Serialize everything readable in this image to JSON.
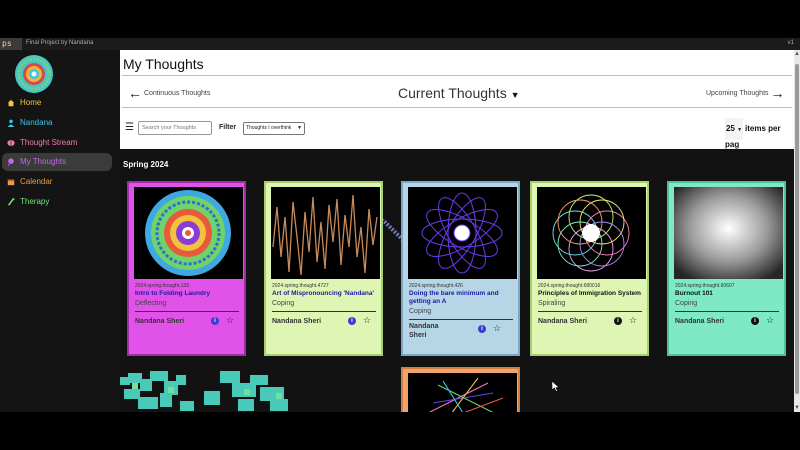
{
  "window": {
    "logo": "ps",
    "title": "Final Project by Nandana",
    "version": "v1"
  },
  "sidebar": {
    "items": [
      {
        "label": "Home",
        "color": "#f4c542",
        "icon": "home-icon"
      },
      {
        "label": "Nandana",
        "color": "#35c8e8",
        "icon": "person-icon"
      },
      {
        "label": "Thought Stream",
        "color": "#f07ab4",
        "icon": "brain-icon"
      },
      {
        "label": "My Thoughts",
        "color": "#c06ae8",
        "icon": "thought-icon"
      },
      {
        "label": "Calendar",
        "color": "#f09a4a",
        "icon": "calendar-icon"
      },
      {
        "label": "Therapy",
        "color": "#6ee66e",
        "icon": "therapy-icon"
      }
    ]
  },
  "page": {
    "title": "My Thoughts"
  },
  "nav": {
    "prev": "Continuous Thoughts",
    "current": "Current Thoughts",
    "next": "Upcoming Thoughts"
  },
  "toolbar": {
    "search_placeholder": "Search your Thoughts",
    "filter_label": "Filter",
    "filter_value": "Thoughts I overthink",
    "per_page": "25",
    "per_page_label": "items per pag"
  },
  "board": {
    "season": "Spring 2024",
    "cards": [
      {
        "id": "2024.spring.thought.133",
        "title": "Intro to Folding Laundry",
        "status": "Deflecting",
        "author": "Nandana Sheri",
        "bg": "#e052e8",
        "border": "#9c2fa6",
        "title_color": "#1a1aa0",
        "info_color": "#3b3bd0"
      },
      {
        "id": "2024.spring.thought.4727",
        "title": "Art of Mispronouncing 'Nandana'",
        "status": "Coping",
        "author": "Nandana Sheri",
        "bg": "#dff5b4",
        "border": "#a6cf6e",
        "title_color": "#1a1aa0",
        "info_color": "#3b3bd0"
      },
      {
        "id": "2024.spring.thought.426",
        "title": "Doing the bare minimum and getting an A",
        "status": "Coping",
        "author": "Nandana Sheri",
        "bg": "#b6d5e6",
        "border": "#7ba9c5",
        "title_color": "#1a1aa0",
        "info_color": "#3b3bd0"
      },
      {
        "id": "2024.spring.thought.680016",
        "title": "Principles of Immigration System",
        "status": "Spiraling",
        "author": "Nandana Sheri",
        "bg": "#dff5b4",
        "border": "#a6cf6e",
        "title_color": "#111111",
        "info_color": "#111111"
      },
      {
        "id": "2024.spring.thought.60607",
        "title": "Burnout 101",
        "status": "Coping",
        "author": "Nandana Sheri",
        "bg": "#7fe8c4",
        "border": "#4cc29b",
        "title_color": "#111111",
        "info_color": "#111111"
      }
    ]
  }
}
